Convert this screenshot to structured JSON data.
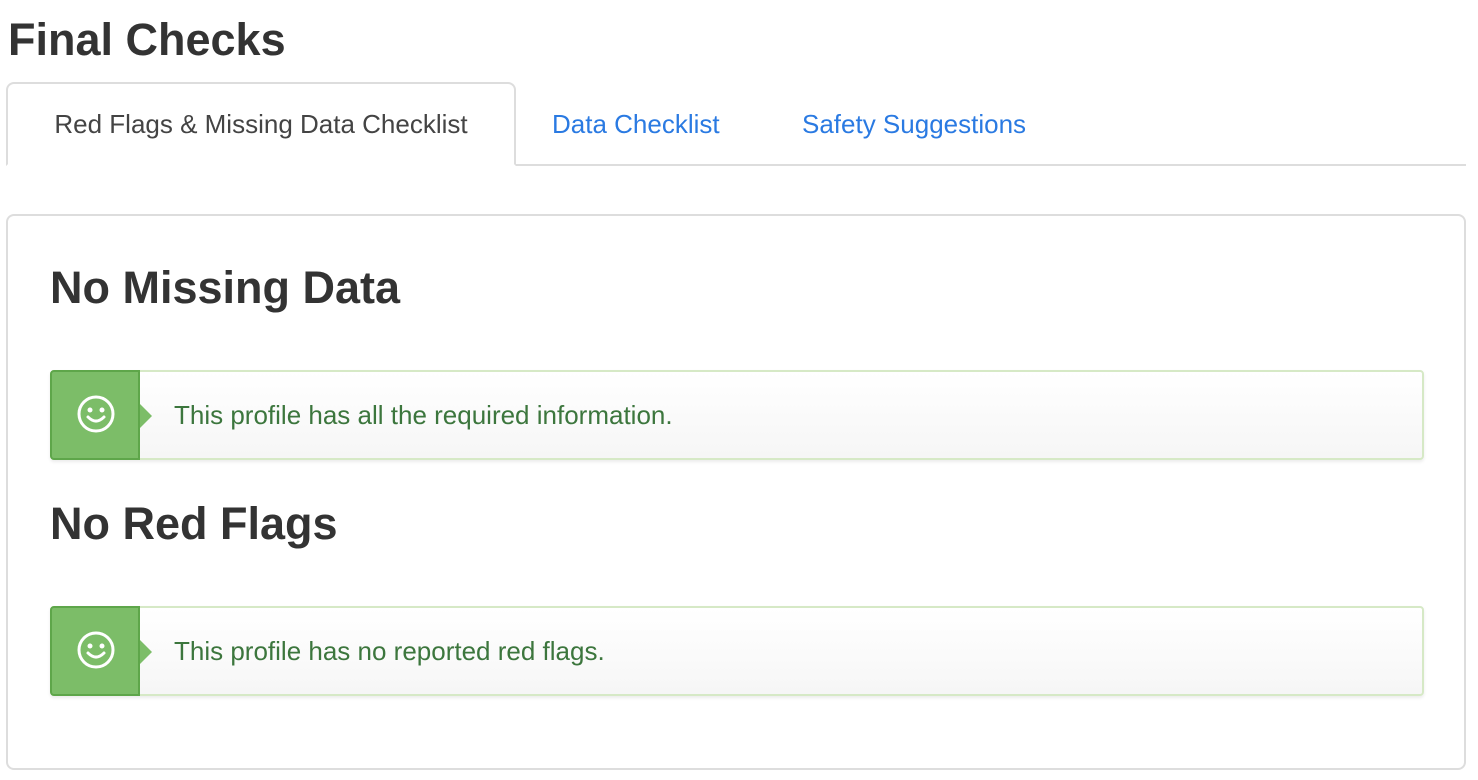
{
  "page": {
    "title": "Final Checks"
  },
  "tabs": [
    {
      "label": "Red Flags & Missing Data Checklist",
      "active": true
    },
    {
      "label": "Data Checklist",
      "active": false
    },
    {
      "label": "Safety Suggestions",
      "active": false
    }
  ],
  "sections": [
    {
      "heading": "No Missing Data",
      "alert": {
        "icon": "smiley-icon",
        "text": "This profile has all the required information."
      }
    },
    {
      "heading": "No Red Flags",
      "alert": {
        "icon": "smiley-icon",
        "text": "This profile has no reported red flags."
      }
    }
  ],
  "colors": {
    "link": "#2a7ae2",
    "success_icon_bg": "#7cbd68",
    "success_text": "#3c763d",
    "border": "#dddddd"
  }
}
